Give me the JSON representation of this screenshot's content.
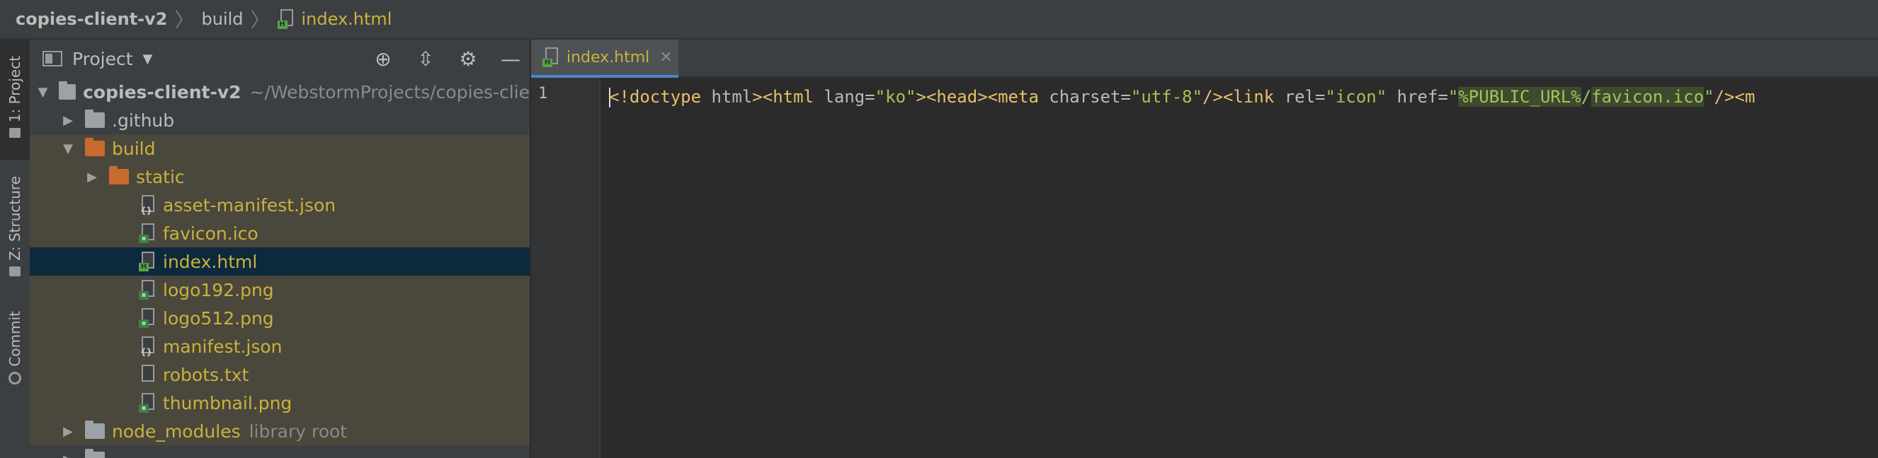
{
  "breadcrumb": {
    "root": "copies-client-v2",
    "folder": "build",
    "file": "index.html"
  },
  "tool_strip": {
    "project_tab": "1: Project",
    "structure_tab": "Z: Structure",
    "commit_tab": "Commit"
  },
  "project_panel": {
    "title": "Project",
    "tree": [
      {
        "name": "copies-client-v2",
        "hint": "~/WebstormProjects/copies-clie"
      },
      {
        "name": ".github"
      },
      {
        "name": "build"
      },
      {
        "name": "static"
      },
      {
        "name": "asset-manifest.json"
      },
      {
        "name": "favicon.ico"
      },
      {
        "name": "index.html"
      },
      {
        "name": "logo192.png"
      },
      {
        "name": "logo512.png"
      },
      {
        "name": "manifest.json"
      },
      {
        "name": "robots.txt"
      },
      {
        "name": "thumbnail.png"
      },
      {
        "name": "node_modules",
        "hint": "library root"
      }
    ]
  },
  "editor": {
    "tab_label": "index.html",
    "line_number": "1",
    "code_tokens": [
      "<!doctype",
      " html",
      "><html",
      " lang=",
      "\"ko\"",
      "><head><meta",
      " charset=",
      "\"utf-8\"",
      "/><link",
      " rel=",
      "\"icon\"",
      " href=",
      "\"",
      "%PUBLIC_URL%",
      "/",
      "favicon.ico",
      "\"",
      "/><m"
    ]
  },
  "colors": {
    "background": "#2b2b2b",
    "panel": "#3c3f41",
    "selection": "#0d293e",
    "modified_text": "#c9b23d",
    "folder_orange": "#c86b2e",
    "tab_underline": "#4a88c7"
  }
}
